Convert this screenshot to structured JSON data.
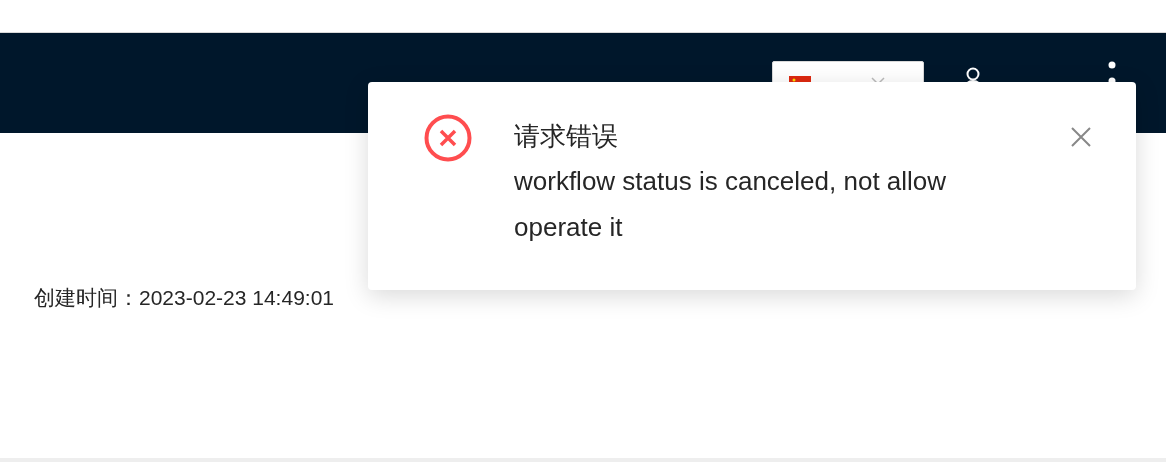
{
  "details": {
    "created_label": "创建时间：",
    "created_value": "2023-02-23 14:49:01"
  },
  "notification": {
    "kind": "error",
    "title": "请求错误",
    "message": "workflow status is canceled, not allow operate it"
  }
}
